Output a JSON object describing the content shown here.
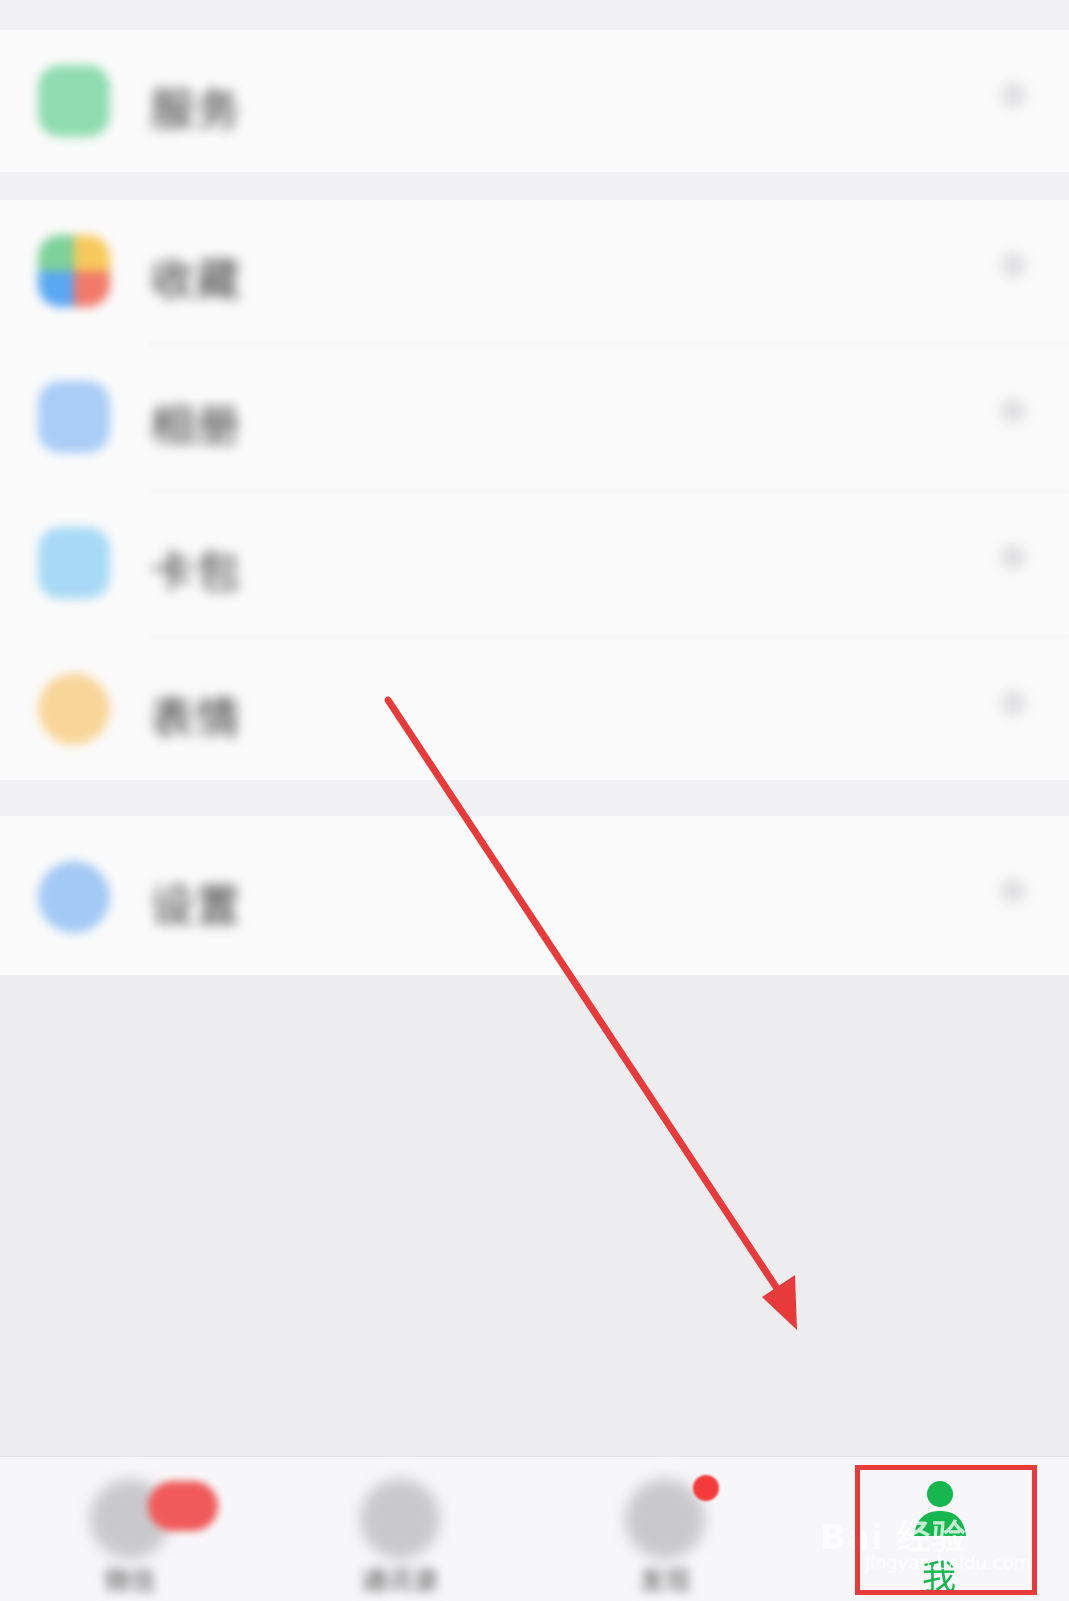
{
  "list_sections": [
    {
      "rows": [
        {
          "label": "服务",
          "icon": "service-icon",
          "color": "#3cc27a"
        }
      ]
    },
    {
      "rows": [
        {
          "label": "收藏",
          "icon": "favorites-icon",
          "color": "#f0a840"
        },
        {
          "label": "相册",
          "icon": "album-icon",
          "color": "#4a8ef0"
        },
        {
          "label": "卡包",
          "icon": "card-pack-icon",
          "color": "#3ca8e8"
        },
        {
          "label": "表情",
          "icon": "sticker-icon",
          "color": "#f3b34a"
        }
      ]
    },
    {
      "rows": [
        {
          "label": "设置",
          "icon": "settings-icon",
          "color": "#3d8ef0"
        }
      ]
    }
  ],
  "tab_bar": {
    "tabs": [
      {
        "label": "微信",
        "icon": "chat-icon",
        "badge": "pill"
      },
      {
        "label": "通讯录",
        "icon": "contacts-icon"
      },
      {
        "label": "发现",
        "icon": "discover-compass-icon",
        "badge": "dot"
      },
      {
        "label": "我",
        "icon": "me-person-icon",
        "active": true
      }
    ],
    "active_color": "#15b74e"
  },
  "watermark": {
    "brand": "Bai 经验",
    "url": "jingyan.baidu.com"
  },
  "annotation_color": "#e83a3a"
}
